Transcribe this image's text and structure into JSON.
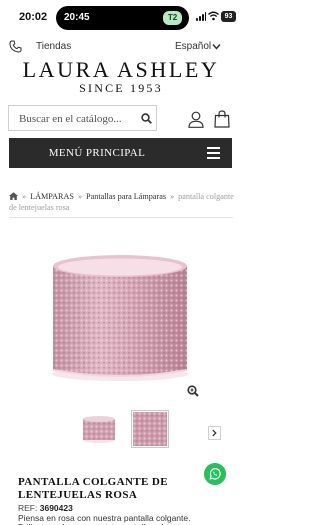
{
  "status_bar": {
    "time": "20:02",
    "island_time": "20:45",
    "island_badge": "T2",
    "battery": "93"
  },
  "header": {
    "stores_label": "Tiendas",
    "language_label": "Español",
    "logo_text": "LAURA ASHLEY",
    "tagline": "SINCE 1953"
  },
  "search": {
    "placeholder": "Buscar en el catálogo..."
  },
  "menu": {
    "label": "MENÚ PRINCIPAL"
  },
  "breadcrumb": {
    "items": [
      "LÁMPARAS",
      "Pantallas para Lámparas"
    ],
    "current": "pantalla colgante de lentejuelas rosa"
  },
  "product": {
    "title": "PANTALLA COLGANTE DE LENTEJUELAS ROSA",
    "ref_label": "REF:",
    "ref_value": "3690423",
    "description": "Piensa en rosa con nuestra pantalla colgante.",
    "description_cont": "Brillante y glamurosa, esta pantalla colgante"
  },
  "colors": {
    "menu_bar": "#2b2b2b",
    "sequin_pink": "#d3a7b6",
    "whatsapp": "#25c15b"
  },
  "icons": [
    "phone-icon",
    "chevron-down-icon",
    "search-icon",
    "user-icon",
    "bag-icon",
    "hamburger-icon",
    "home-icon",
    "zoom-icon",
    "chevron-right-icon",
    "whatsapp-icon"
  ]
}
